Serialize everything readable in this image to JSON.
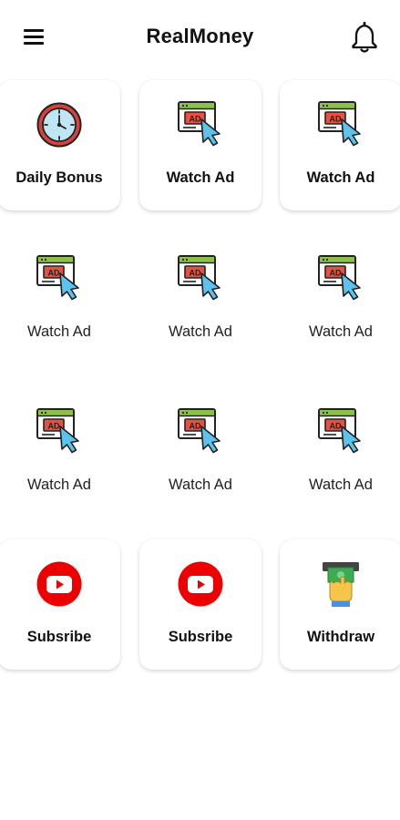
{
  "app": {
    "title": "RealMoney"
  },
  "icons": {
    "menu": "menu-icon",
    "bell": "bell-icon",
    "clock": "clock-icon",
    "ad": "ad-click-icon",
    "youtube": "youtube-icon",
    "cash": "cash-withdraw-icon"
  },
  "colors": {
    "youtube_red": "#ee0000",
    "ad_green": "#8cc14a",
    "ad_red": "#e8503f",
    "cursor_blue": "#5cc3ee",
    "clock_face": "#bfe6f5",
    "clock_rim": "#d8413c"
  },
  "tiles": [
    {
      "label": "Daily Bonus",
      "icon": "clock-icon"
    },
    {
      "label": "Watch Ad",
      "icon": "ad-click-icon"
    },
    {
      "label": "Watch Ad",
      "icon": "ad-click-icon"
    },
    {
      "label": "Watch Ad",
      "icon": "ad-click-icon"
    },
    {
      "label": "Watch Ad",
      "icon": "ad-click-icon"
    },
    {
      "label": "Watch Ad",
      "icon": "ad-click-icon"
    },
    {
      "label": "Watch Ad",
      "icon": "ad-click-icon"
    },
    {
      "label": "Watch Ad",
      "icon": "ad-click-icon"
    },
    {
      "label": "Watch Ad",
      "icon": "ad-click-icon"
    },
    {
      "label": "Subsribe",
      "icon": "youtube-icon"
    },
    {
      "label": "Subsribe",
      "icon": "youtube-icon"
    },
    {
      "label": "Withdraw",
      "icon": "cash-withdraw-icon"
    }
  ]
}
